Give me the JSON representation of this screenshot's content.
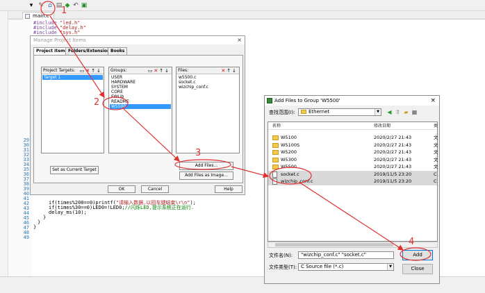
{
  "editor": {
    "tab_label": "main.c",
    "line_numbers": [
      "29",
      "30",
      "31",
      "32",
      "33",
      "34",
      "35",
      "36",
      "37",
      "38",
      "39",
      "40",
      "41",
      "42",
      "43",
      "44",
      "45",
      "46",
      "47",
      "48",
      "49"
    ],
    "code_include_1_kw": "#include ",
    "code_include_1_str": "\"led.h\"",
    "code_include_2_kw": "#include ",
    "code_include_2_str": "\"delay.h\"",
    "code_include_3_kw": "#include ",
    "code_include_3_str": "\"sys.h\"",
    "code_if1": "if(times%200==0)printf(",
    "code_if1_str": "\"请输入数据,以回车键结束\\r\\n\"",
    "code_if1_end": ");",
    "code_if2": "if(times%30==0)LED0=!LED0;",
    "code_if2_cm": "//闪烁LED,提示系统正在运行.",
    "code_delay": "delay_ms(10);",
    "code_close1": "}",
    "code_close2": "}",
    "code_close3": "}"
  },
  "manage_dialog": {
    "title": "Manage Project Items",
    "close": "×",
    "tabs": [
      "Project Items",
      "Folders/Extensions",
      "Books"
    ],
    "targets": {
      "header": "Project Targets:",
      "items": [
        "Target 1"
      ]
    },
    "groups": {
      "header": "Groups:",
      "items": [
        "USER",
        "HARDWARE",
        "SYSTEM",
        "CORE",
        "FWLib",
        "README",
        "W5500"
      ],
      "selected": "W5500"
    },
    "files": {
      "header": "Files:",
      "items": [
        "w5500.c",
        "socket.c",
        "wizchip_conf.c"
      ]
    },
    "set_target_button": "Set as Current Target",
    "add_files_button": "Add Files...",
    "add_files_image_button": "Add Files as Image...",
    "ok_button": "OK",
    "cancel_button": "Cancel",
    "help_button": "Help"
  },
  "add_files_dialog": {
    "title": "Add Files to Group 'W5500'",
    "close": "×",
    "look_in_label": "查找范围(I):",
    "look_in_value": "Ethernet",
    "columns": {
      "name": "名称",
      "date": "修改日期",
      "type": "类"
    },
    "rows": [
      {
        "name": "W5100",
        "date": "2020/2/27 21:43",
        "type": "文",
        "kind": "folder"
      },
      {
        "name": "W5100S",
        "date": "2020/2/27 21:43",
        "type": "文",
        "kind": "folder"
      },
      {
        "name": "W5200",
        "date": "2020/2/27 21:43",
        "type": "文",
        "kind": "folder"
      },
      {
        "name": "W5300",
        "date": "2020/2/27 21:43",
        "type": "文",
        "kind": "folder"
      },
      {
        "name": "W5500",
        "date": "2020/2/27 21:43",
        "type": "文",
        "kind": "folder"
      },
      {
        "name": "socket.c",
        "date": "2019/11/5 23:20",
        "type": "C",
        "kind": "file"
      },
      {
        "name": "wizchip_conf.c",
        "date": "2019/11/5 23:20",
        "type": "C",
        "kind": "file"
      }
    ],
    "filename_label": "文件名(N):",
    "filename_value": "\"wizchip_conf.c\" \"socket.c\"",
    "filetype_label": "文件类型(T):",
    "filetype_value": "C Source file (*.c)",
    "add_button": "Add",
    "close_button": "Close"
  },
  "annotations": {
    "steps": [
      "1",
      "2",
      "3",
      "4"
    ],
    "color": "#e03030"
  }
}
